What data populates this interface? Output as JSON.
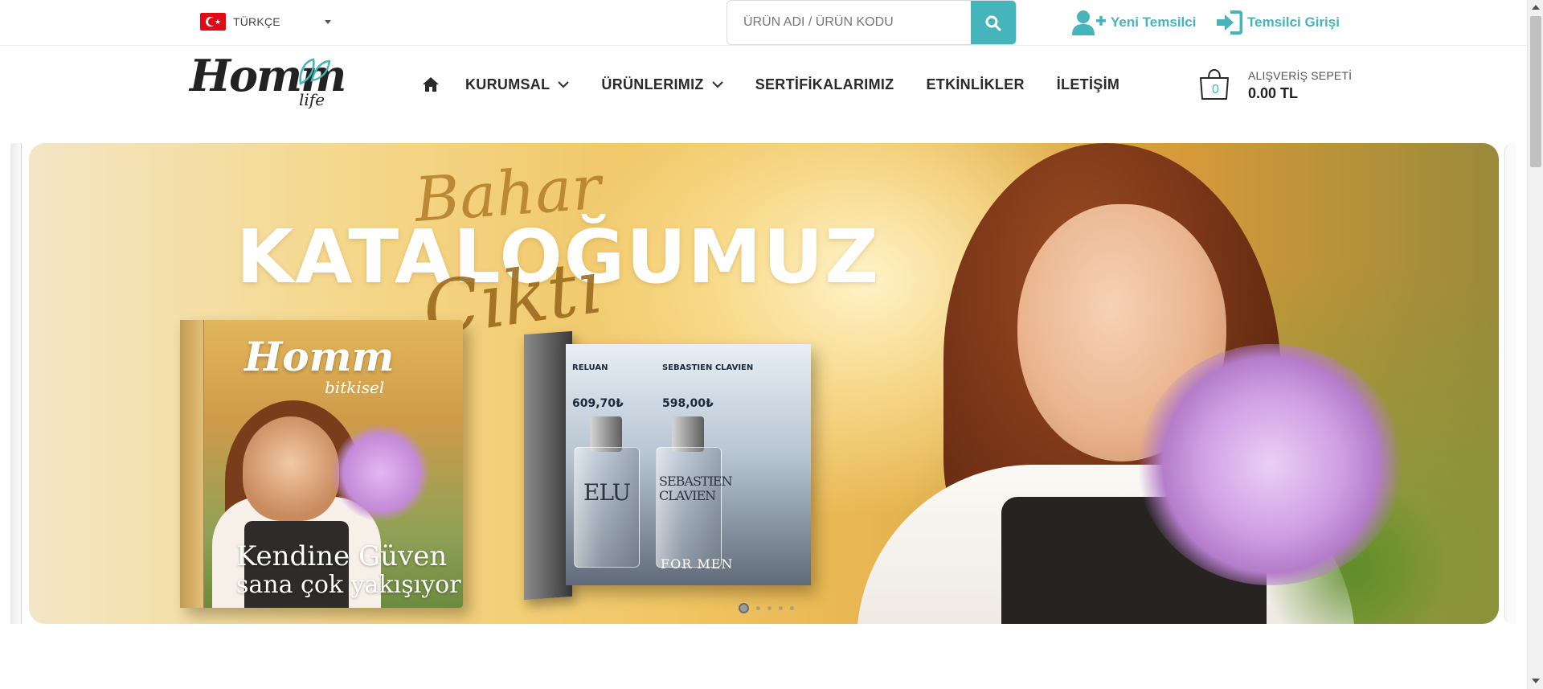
{
  "topbar": {
    "language": "TÜRKÇE",
    "search_placeholder": "ÜRÜN ADI / ÜRÜN KODU",
    "new_rep": "Yeni Temsilci",
    "rep_login": "Temsilci Girişi"
  },
  "brand": {
    "logo_word": "Homm",
    "logo_sub": "life",
    "accent_color": "#45b4bb"
  },
  "nav": {
    "items": [
      {
        "label": "KURUMSAL",
        "has_dropdown": true
      },
      {
        "label": "ÜRÜNLERIMIZ",
        "has_dropdown": true
      },
      {
        "label": "SERTİFİKALARIMIZ",
        "has_dropdown": false
      },
      {
        "label": "ETKİNLİKLER",
        "has_dropdown": false
      },
      {
        "label": "İLETİŞİM",
        "has_dropdown": false
      }
    ]
  },
  "cart": {
    "count": "0",
    "label": "ALIŞVERİŞ SEPETİ",
    "total": "0.00 TL"
  },
  "slider": {
    "script_top": "Bahar",
    "headline": "KATALOĞUMUZ",
    "script_bottom": "Çıktı",
    "book_logo": "Homm",
    "book_logo_sub": "bitkisel",
    "book_tagline_1": "Kendine Güven",
    "book_tagline_2": "sana çok yakışıyor",
    "products": [
      {
        "name": "RELUAN",
        "price": "609,70₺",
        "bottle_text": "ELU"
      },
      {
        "name": "SEBASTIEN CLAVIEN",
        "price": "598,00₺",
        "bottle_text": "SEBASTIEN CLAVIEN"
      }
    ],
    "catalog_footer": "FOR MEN",
    "slide_count": 5,
    "active_slide": 1
  }
}
